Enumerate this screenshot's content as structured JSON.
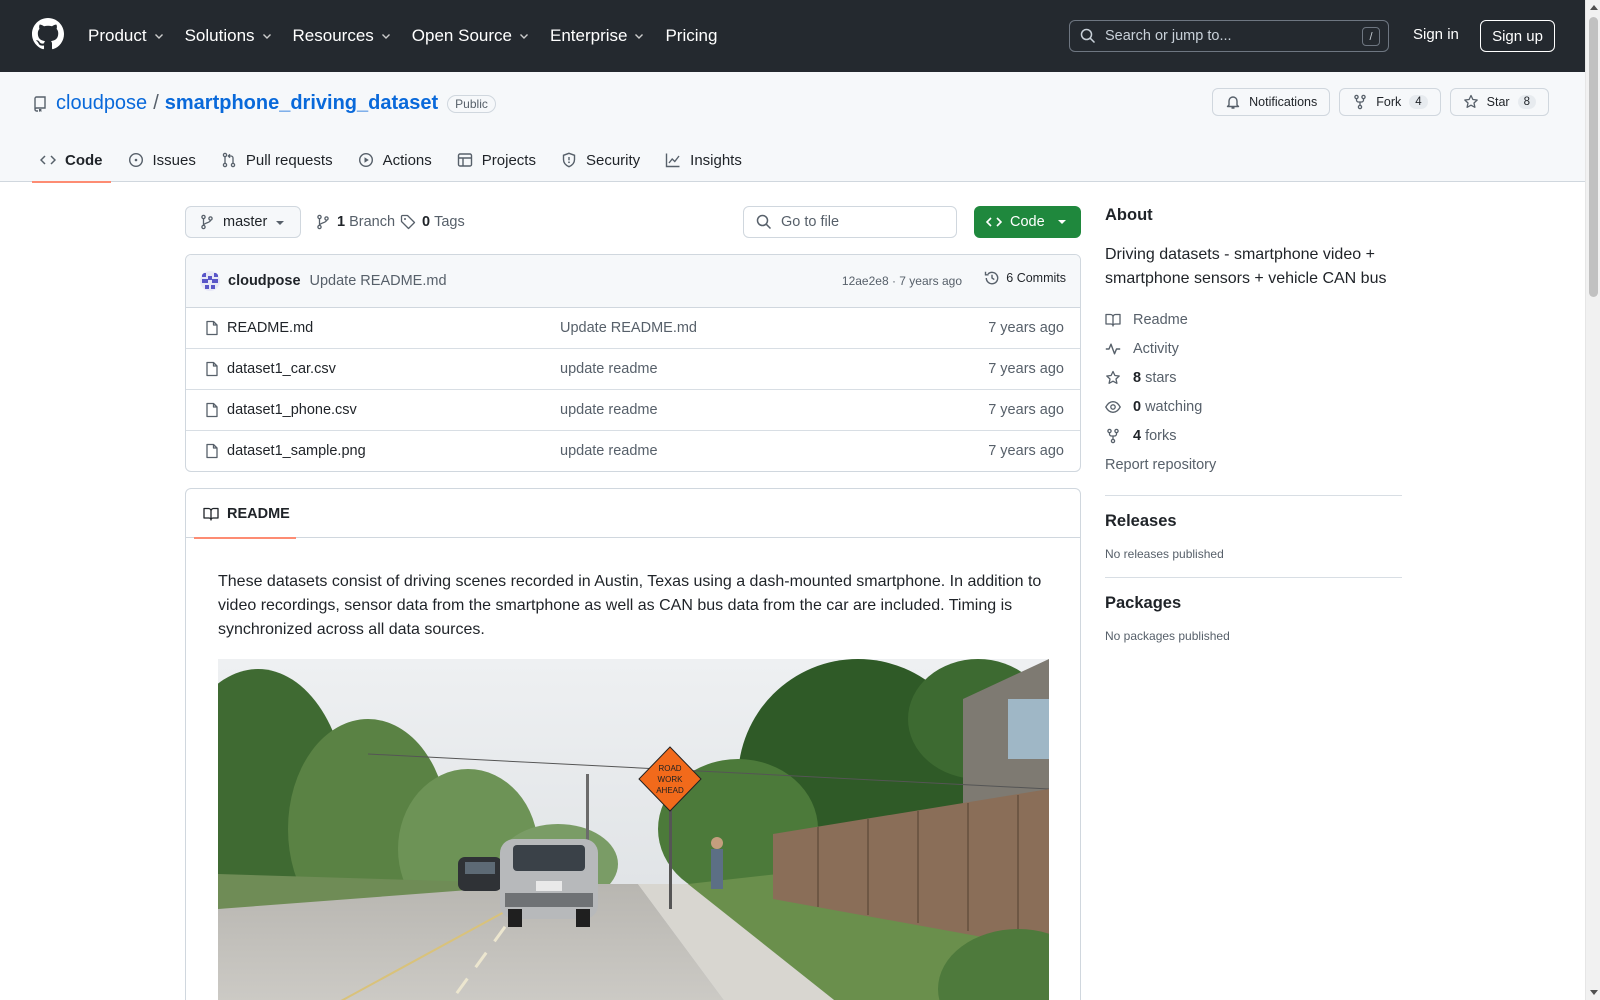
{
  "header": {
    "nav": [
      {
        "label": "Product",
        "dropdown": true
      },
      {
        "label": "Solutions",
        "dropdown": true
      },
      {
        "label": "Resources",
        "dropdown": true
      },
      {
        "label": "Open Source",
        "dropdown": true
      },
      {
        "label": "Enterprise",
        "dropdown": true
      },
      {
        "label": "Pricing",
        "dropdown": false
      }
    ],
    "search_placeholder": "Search or jump to...",
    "search_shortcut": "/",
    "sign_in": "Sign in",
    "sign_up": "Sign up"
  },
  "repo": {
    "owner": "cloudpose",
    "separator": "/",
    "name": "smartphone_driving_dataset",
    "visibility": "Public",
    "actions": {
      "notifications": "Notifications",
      "fork": "Fork",
      "fork_count": "4",
      "star": "Star",
      "star_count": "8"
    },
    "tabs": [
      {
        "label": "Code",
        "icon": "code-icon",
        "active": true
      },
      {
        "label": "Issues",
        "icon": "issue-icon",
        "active": false
      },
      {
        "label": "Pull requests",
        "icon": "pull-request-icon",
        "active": false
      },
      {
        "label": "Actions",
        "icon": "play-icon",
        "active": false
      },
      {
        "label": "Projects",
        "icon": "table-icon",
        "active": false
      },
      {
        "label": "Security",
        "icon": "shield-icon",
        "active": false
      },
      {
        "label": "Insights",
        "icon": "graph-icon",
        "active": false
      }
    ]
  },
  "toolbar": {
    "branch": "master",
    "branch_count": "1",
    "branch_label": "Branch",
    "tag_count": "0",
    "tag_label": "Tags",
    "goto_file": "Go to file",
    "code_button": "Code"
  },
  "commit": {
    "author": "cloudpose",
    "message": "Update README.md",
    "hash": "12ae2e8",
    "age": "7 years ago",
    "meta": "12ae2e8 · 7 years ago",
    "commits_label": "6 Commits"
  },
  "files": [
    {
      "name": "README.md",
      "message": "Update README.md",
      "age": "7 years ago"
    },
    {
      "name": "dataset1_car.csv",
      "message": "update readme",
      "age": "7 years ago"
    },
    {
      "name": "dataset1_phone.csv",
      "message": "update readme",
      "age": "7 years ago"
    },
    {
      "name": "dataset1_sample.png",
      "message": "update readme",
      "age": "7 years ago"
    }
  ],
  "readme": {
    "tab_label": "README",
    "text": "These datasets consist of driving scenes recorded in Austin, Texas using a dash-mounted smartphone. In addition to video recordings, sensor data from the smartphone as well as CAN bus data from the car are included. Timing is synchronized across all data sources.",
    "sign_text": [
      "ROAD",
      "WORK",
      "AHEAD"
    ]
  },
  "sidebar": {
    "about_title": "About",
    "description": "Driving datasets - smartphone video + smartphone sensors + vehicle CAN bus",
    "readme": "Readme",
    "activity": "Activity",
    "stars_count": "8",
    "stars_label": "stars",
    "watching_count": "0",
    "watching_label": "watching",
    "forks_count": "4",
    "forks_label": "forks",
    "report": "Report repository",
    "releases_title": "Releases",
    "releases_note": "No releases published",
    "packages_title": "Packages",
    "packages_note": "No packages published"
  },
  "colors": {
    "header_bg": "#24292f",
    "link": "#0969da",
    "primary_button": "#1f883d",
    "active_tab_underline": "#fd8c73"
  }
}
